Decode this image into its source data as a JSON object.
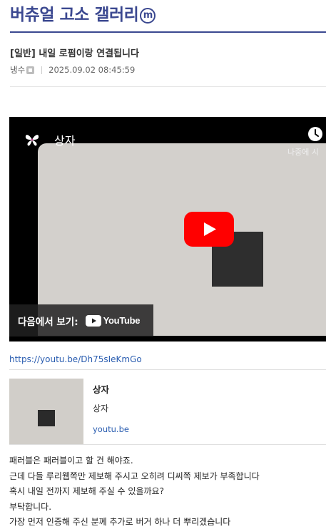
{
  "gallery": {
    "title": "버츄얼 고소 갤러리",
    "badge": "m"
  },
  "post": {
    "title": "[일반] 내일 로펌이랑 연결됩니다",
    "author": "냉수",
    "date": "2025.09.02 08:45:59"
  },
  "video": {
    "title": "상자",
    "watch_later": "나중에 시",
    "watch_on_label": "다음에서 보기:",
    "platform": "YouTube",
    "link": "https://youtu.be/Dh75sIeKmGo"
  },
  "link_card": {
    "title": "상자",
    "description": "상자",
    "domain": "youtu.be"
  },
  "body_lines": [
    "패러블은 패러블이고 할 건 해야죠.",
    "근데 다들 루리웹쪽만 제보해 주시고 오히려 디씨쪽 제보가 부족합니다",
    "혹시 내일 전까지 제보해 주실 수 있을까요?",
    "부탁합니다.",
    "가장 먼저 인증해 주신 분께 추가로 버거 하나 더 뿌리겠습니다"
  ],
  "colors": {
    "brand": "#3b4890",
    "link": "#2a5db0",
    "youtube_red": "#ff0000"
  },
  "icons": {
    "channel": "butterfly-icon",
    "watch_later": "clock-icon",
    "play": "youtube-play-icon",
    "nickname": "nickname-icon",
    "minor_gallery": "minor-gallery-icon"
  }
}
